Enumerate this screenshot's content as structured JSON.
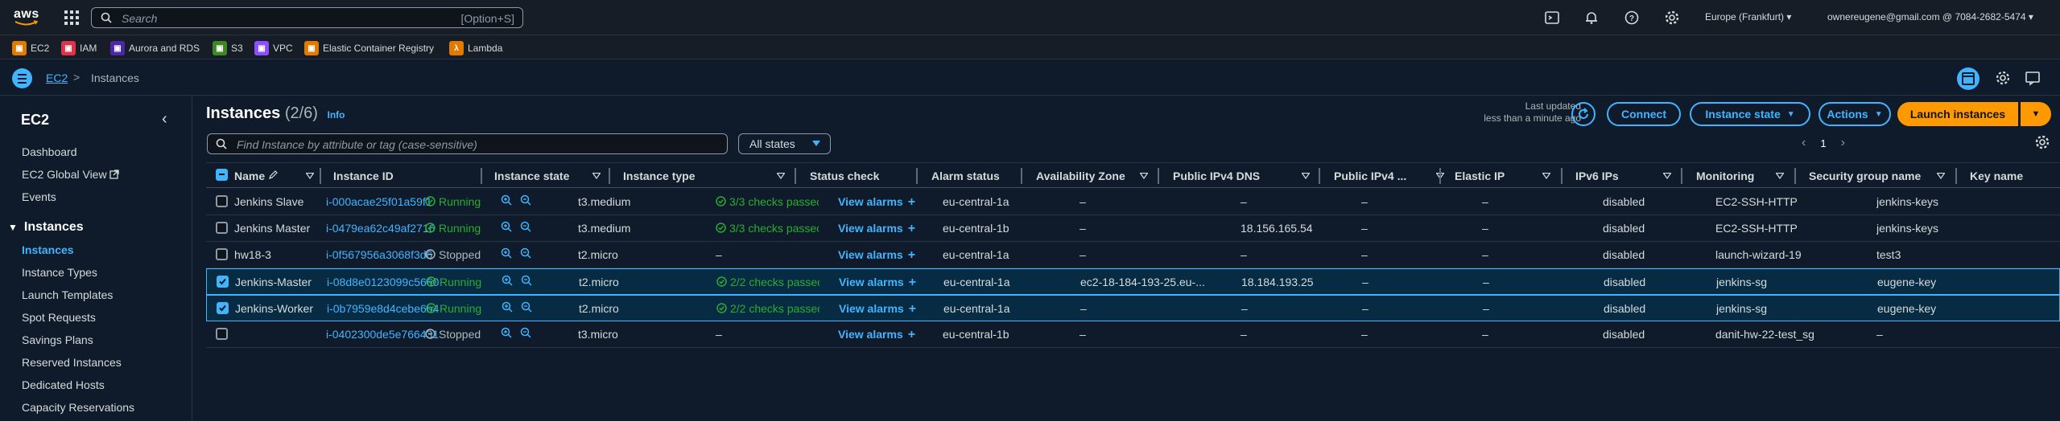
{
  "topnav": {
    "logo_text": "aws",
    "search_placeholder": "Search",
    "search_shortcut": "[Option+S]",
    "region": "Europe (Frankfurt) ▾",
    "account": "ownereugene@gmail.com @ 7084-2682-5474 ▾"
  },
  "favorites": [
    {
      "label": "EC2",
      "color": "#e07b00"
    },
    {
      "label": "IAM",
      "color": "#dd344c"
    },
    {
      "label": "Aurora and RDS",
      "color": "#4d27aa"
    },
    {
      "label": "S3",
      "color": "#3f8624"
    },
    {
      "label": "VPC",
      "color": "#8c4fff"
    },
    {
      "label": "Elastic Container Registry",
      "color": "#e07b00"
    },
    {
      "label": "Lambda",
      "color": "#e07b00"
    }
  ],
  "breadcrumb": {
    "root": "EC2",
    "sep": ">",
    "current": "Instances"
  },
  "sidebar": {
    "title": "EC2",
    "top_items": [
      "Dashboard",
      "EC2 Global View",
      "Events"
    ],
    "section": "Instances",
    "section_items": [
      "Instances",
      "Instance Types",
      "Launch Templates",
      "Spot Requests",
      "Savings Plans",
      "Reserved Instances",
      "Dedicated Hosts",
      "Capacity Reservations"
    ]
  },
  "main": {
    "title": "Instances",
    "count": "(2/6)",
    "info": "Info",
    "updated_line1": "Last updated",
    "updated_line2": "less than a minute ago",
    "connect": "Connect",
    "instance_state": "Instance state",
    "actions": "Actions",
    "launch": "Launch instances",
    "filter_placeholder": "Find Instance by attribute or tag (case-sensitive)",
    "states_label": "All states",
    "page": "1"
  },
  "columns": [
    "Name",
    "Instance ID",
    "Instance state",
    "Instance type",
    "Status check",
    "Alarm status",
    "Availability Zone",
    "Public IPv4 DNS",
    "Public IPv4 ...",
    "Elastic IP",
    "IPv6 IPs",
    "Monitoring",
    "Security group name",
    "Key name"
  ],
  "rows": [
    {
      "name": "Jenkins Slave",
      "id": "i-000acae25f01a59f1",
      "state": "Running",
      "type": "t3.medium",
      "status": "3/3 checks passec",
      "alarm": "View alarms",
      "az": "eu-central-1a",
      "dns": "–",
      "ip": "–",
      "eip": "–",
      "ipv6": "–",
      "mon": "disabled",
      "sg": "EC2-SSH-HTTP",
      "key": "jenkins-keys",
      "selected": false
    },
    {
      "name": "Jenkins Master",
      "id": "i-0479ea62c49af2716",
      "state": "Running",
      "type": "t3.medium",
      "status": "3/3 checks passec",
      "alarm": "View alarms",
      "az": "eu-central-1b",
      "dns": "–",
      "ip": "18.156.165.54",
      "eip": "–",
      "ipv6": "–",
      "mon": "disabled",
      "sg": "EC2-SSH-HTTP",
      "key": "jenkins-keys",
      "selected": false
    },
    {
      "name": "hw18-3",
      "id": "i-0f567956a3068f3d6",
      "state": "Stopped",
      "type": "t2.micro",
      "status": "–",
      "alarm": "View alarms",
      "az": "eu-central-1a",
      "dns": "–",
      "ip": "–",
      "eip": "–",
      "ipv6": "–",
      "mon": "disabled",
      "sg": "launch-wizard-19",
      "key": "test3",
      "selected": false
    },
    {
      "name": "Jenkins-Master",
      "id": "i-08d8e0123099c5660",
      "state": "Running",
      "type": "t2.micro",
      "status": "2/2 checks passec",
      "alarm": "View alarms",
      "az": "eu-central-1a",
      "dns": "ec2-18-184-193-25.eu-...",
      "ip": "18.184.193.25",
      "eip": "–",
      "ipv6": "–",
      "mon": "disabled",
      "sg": "jenkins-sg",
      "key": "eugene-key",
      "selected": true
    },
    {
      "name": "Jenkins-Worker",
      "id": "i-0b7959e8d4cebe6b4",
      "state": "Running",
      "type": "t2.micro",
      "status": "2/2 checks passec",
      "alarm": "View alarms",
      "az": "eu-central-1a",
      "dns": "–",
      "ip": "–",
      "eip": "–",
      "ipv6": "–",
      "mon": "disabled",
      "sg": "jenkins-sg",
      "key": "eugene-key",
      "selected": true
    },
    {
      "name": "",
      "id": "i-0402300de5e766431",
      "state": "Stopped",
      "type": "t3.micro",
      "status": "–",
      "alarm": "View alarms",
      "az": "eu-central-1b",
      "dns": "–",
      "ip": "–",
      "eip": "–",
      "ipv6": "–",
      "mon": "disabled",
      "sg": "danit-hw-22-test_sg",
      "key": "–",
      "selected": false
    }
  ]
}
